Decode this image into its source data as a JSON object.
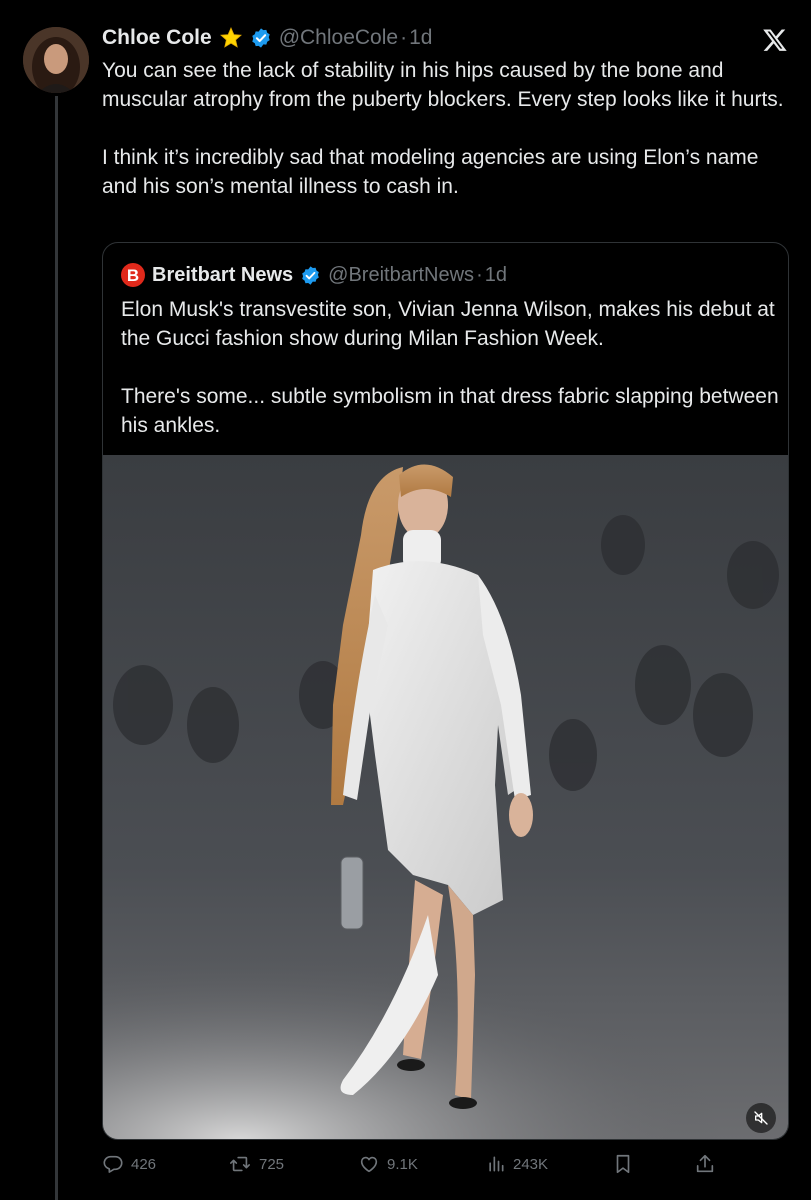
{
  "post": {
    "author_name": "Chloe Cole",
    "badge_icon": "star-badge-icon",
    "verified_icon": "verified-badge-icon",
    "handle": "@ChloeCole",
    "separator": "·",
    "time": "1d",
    "paragraphs": [
      "You can see the lack of stability in his hips caused by the bone and muscular atrophy from the puberty blockers. Every step looks like it hurts.",
      "I think it’s incredibly sad that modeling agencies are using Elon’s name and his son’s mental illness to cash in."
    ]
  },
  "quote": {
    "author_name": "Breitbart News",
    "logo_letter": "B",
    "handle": "@BreitbartNews",
    "separator": "·",
    "time": "1d",
    "paragraphs": [
      "Elon Musk's transvestite son, Vivian Jenna Wilson, makes his debut at the Gucci fashion show during Milan Fashion Week.",
      "There's some... subtle symbolism in that dress fabric slapping between his ankles."
    ]
  },
  "actions": {
    "replies": "426",
    "reposts": "725",
    "likes": "9.1K",
    "views": "243K"
  },
  "colors": {
    "background": "#000000",
    "text": "#e7e9ea",
    "secondary": "#71767b",
    "verified": "#1d9bf0",
    "star": "#ffd400",
    "breitbart_red": "#e0291b",
    "border": "#2f3336"
  }
}
